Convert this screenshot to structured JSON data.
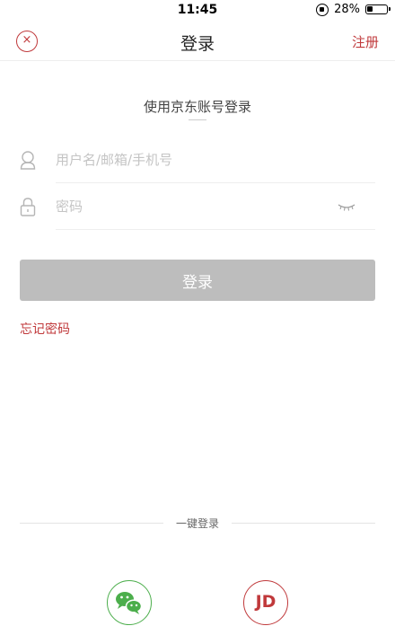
{
  "status_bar": {
    "time": "11:45",
    "battery": "28%"
  },
  "nav": {
    "close_symbol": "×",
    "title": "登录",
    "register_label": "注册"
  },
  "login": {
    "heading": "使用京东账号登录",
    "username_placeholder": "用户名/邮箱/手机号",
    "password_placeholder": "密码",
    "submit_label": "登录",
    "forgot_label": "忘记密码"
  },
  "quick_login": {
    "label": "一键登录",
    "jd_label": "JD"
  },
  "colors": {
    "accent": "#c0393b",
    "wechat": "#4cae4c",
    "button_disabled": "#bdbdbd"
  },
  "icons": [
    "lock-rotation-icon",
    "battery-icon",
    "close-icon",
    "user-icon",
    "lock-icon",
    "eye-closed-icon",
    "wechat-icon"
  ]
}
